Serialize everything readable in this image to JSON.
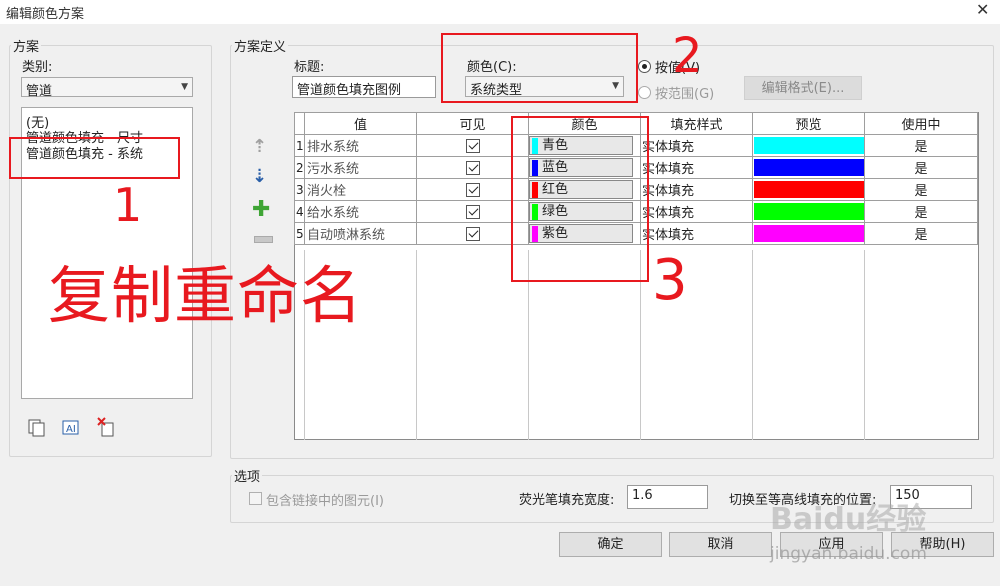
{
  "window": {
    "title": "编辑颜色方案",
    "close_glyph": "✕"
  },
  "scheme": {
    "group_label": "方案",
    "category_label": "类别:",
    "category_value": "管道",
    "items": [
      "(无)",
      "管道颜色填充 - 尺寸",
      "管道颜色填充 - 系统"
    ]
  },
  "definition": {
    "group_label": "方案定义",
    "title_label": "标题:",
    "title_value": "管道颜色填充图例",
    "color_label": "颜色(C):",
    "color_value": "系统类型",
    "by_value_label": "按值(V)",
    "by_range_label": "按范围(G)",
    "edit_format_label": "编辑格式(E)..."
  },
  "table": {
    "headers": [
      "值",
      "可见",
      "颜色",
      "填充样式",
      "预览",
      "使用中"
    ],
    "rows": [
      {
        "num": "1",
        "value": "排水系统",
        "color_name": "青色",
        "color": "#00ffff",
        "fill": "实体填充",
        "in_use": "是"
      },
      {
        "num": "2",
        "value": "污水系统",
        "color_name": "蓝色",
        "color": "#0000ff",
        "fill": "实体填充",
        "in_use": "是"
      },
      {
        "num": "3",
        "value": "消火栓",
        "color_name": "红色",
        "color": "#ff0000",
        "fill": "实体填充",
        "in_use": "是"
      },
      {
        "num": "4",
        "value": "给水系统",
        "color_name": "绿色",
        "color": "#00ff00",
        "fill": "实体填充",
        "in_use": "是"
      },
      {
        "num": "5",
        "value": "自动喷淋系统",
        "color_name": "紫色",
        "color": "#ff00ff",
        "fill": "实体填充",
        "in_use": "是"
      }
    ]
  },
  "options": {
    "group_label": "选项",
    "include_links_label": "包含链接中的图元(I)",
    "fill_width_label": "荧光笔填充宽度:",
    "fill_width_value": "1.6",
    "contour_label": "切换至等高线填充的位置:",
    "contour_value": "150"
  },
  "buttons": {
    "ok": "确定",
    "cancel": "取消",
    "apply": "应用",
    "help": "帮助(H)"
  },
  "annotations": {
    "one": "1",
    "two": "2",
    "three": "3",
    "text": "复制重命名"
  },
  "watermark": {
    "logo": "Baidu经验",
    "url": "jingyan.baidu.com"
  },
  "colors": {
    "annotation": "#e8191f"
  }
}
